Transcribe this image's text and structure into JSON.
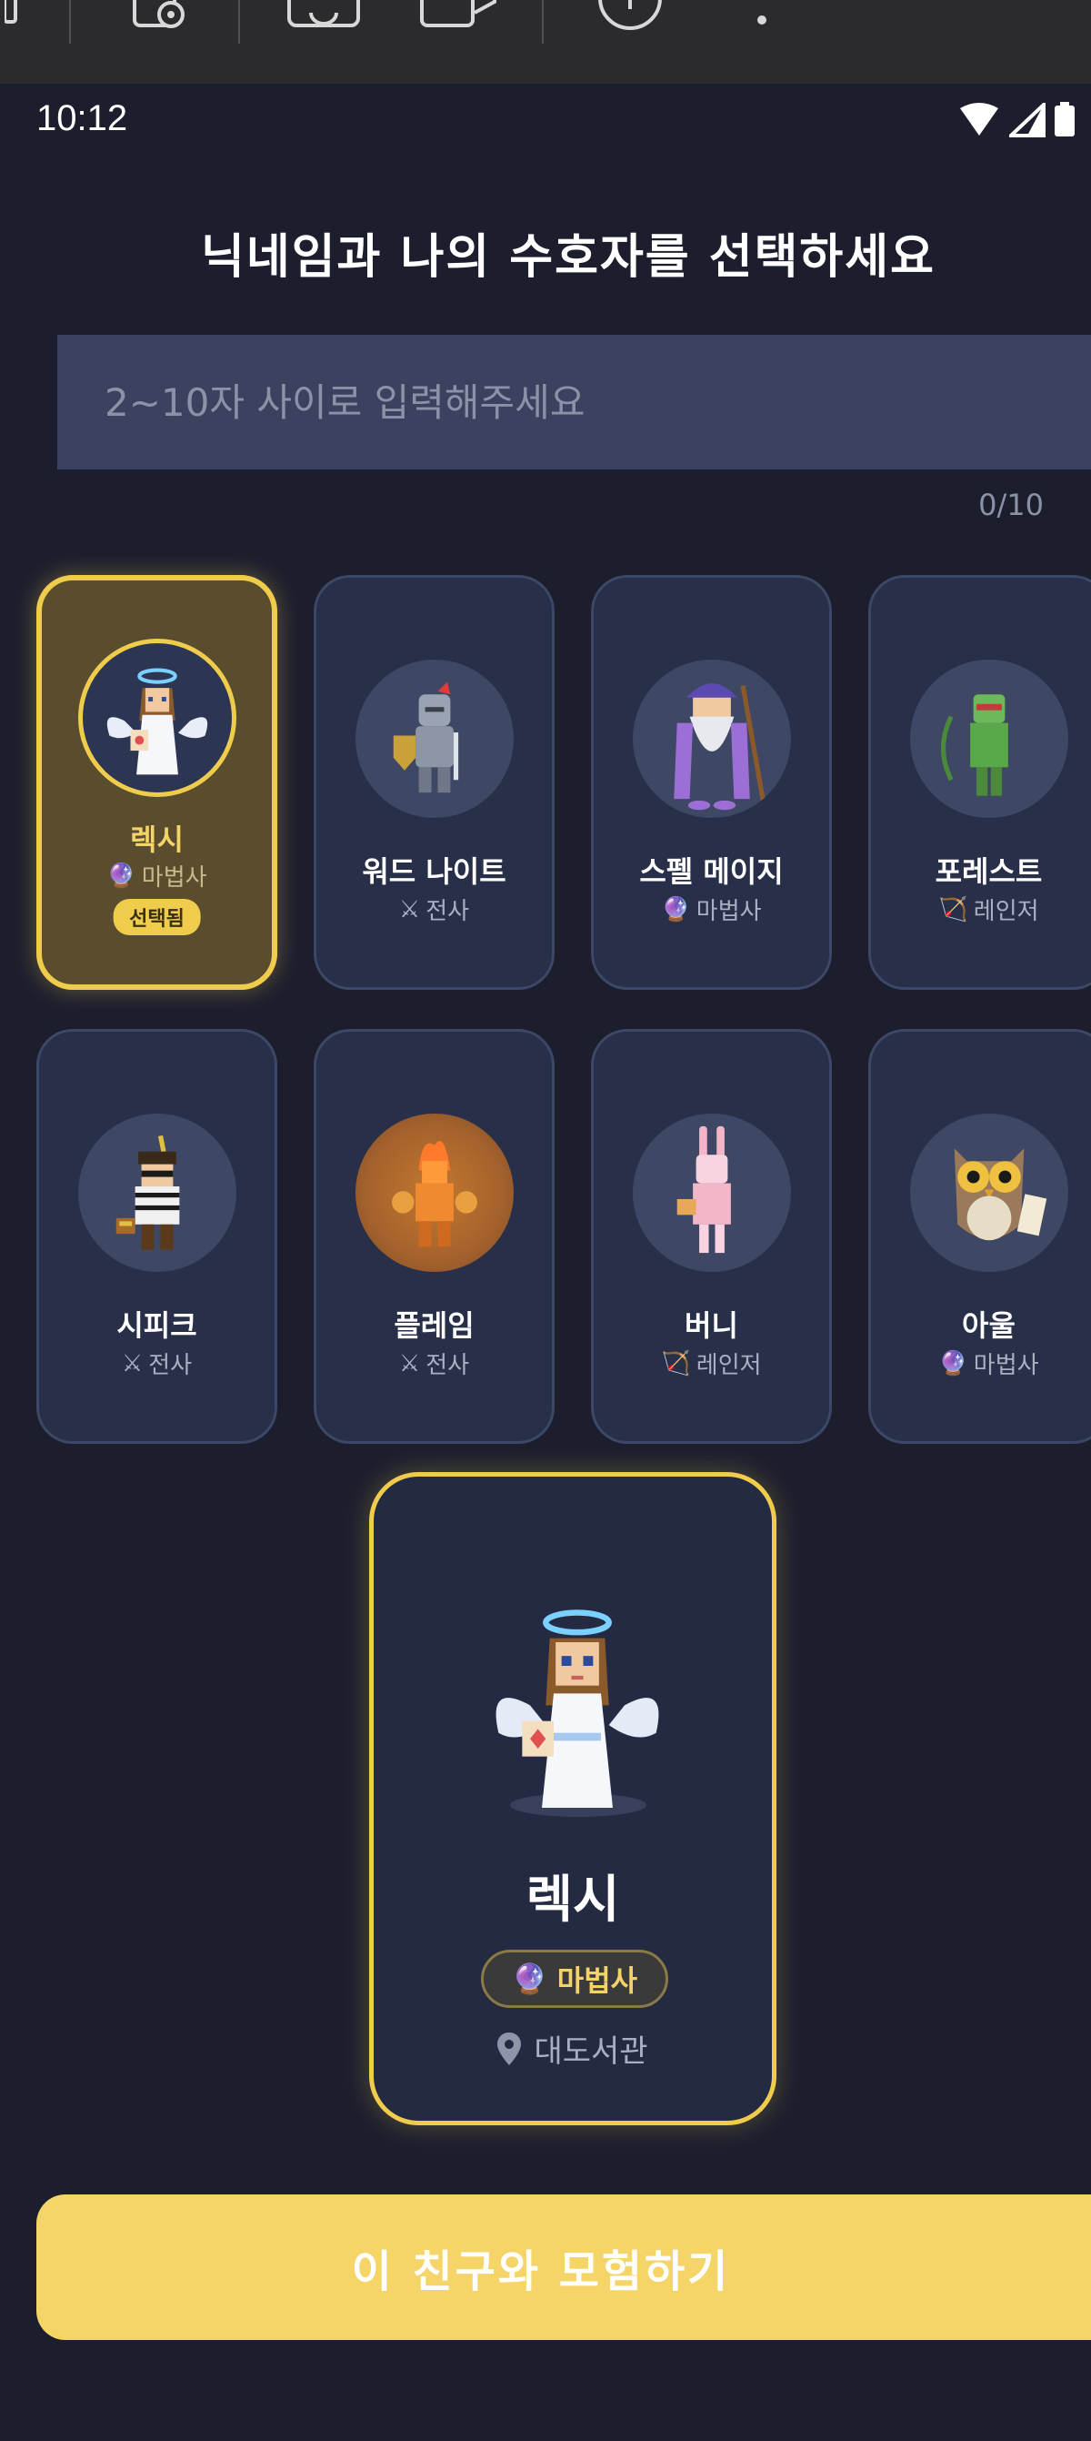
{
  "status_bar": {
    "time": "10:12"
  },
  "title": "닉네임과 나의 수호자를 선택하세요",
  "nickname": {
    "placeholder": "2~10자 사이로 입력해주세요",
    "value": "",
    "counter": "0/10"
  },
  "characters": [
    {
      "name": "렉시",
      "class": "마법사",
      "class_icon": "crystal-ball-icon",
      "selected": true,
      "badge": "선택됨"
    },
    {
      "name": "워드 나이트",
      "class": "전사",
      "class_icon": "crossed-swords-icon",
      "selected": false
    },
    {
      "name": "스펠 메이지",
      "class": "마법사",
      "class_icon": "crystal-ball-icon",
      "selected": false
    },
    {
      "name": "포레스트",
      "class": "레인저",
      "class_icon": "bow-icon",
      "selected": false
    },
    {
      "name": "시피크",
      "class": "전사",
      "class_icon": "crossed-swords-icon",
      "selected": false
    },
    {
      "name": "플레임",
      "class": "전사",
      "class_icon": "crossed-swords-icon",
      "selected": false
    },
    {
      "name": "버니",
      "class": "레인저",
      "class_icon": "bow-icon",
      "selected": false
    },
    {
      "name": "아울",
      "class": "마법사",
      "class_icon": "crystal-ball-icon",
      "selected": false
    }
  ],
  "detail": {
    "name": "렉시",
    "class": "마법사",
    "location": "대도서관"
  },
  "cta_label": "이 친구와 모험하기",
  "colors": {
    "background": "#1c1e2e",
    "card": "#283049",
    "accent": "#f0cc4d",
    "input": "#3a4260",
    "cta": "#f5d468"
  }
}
